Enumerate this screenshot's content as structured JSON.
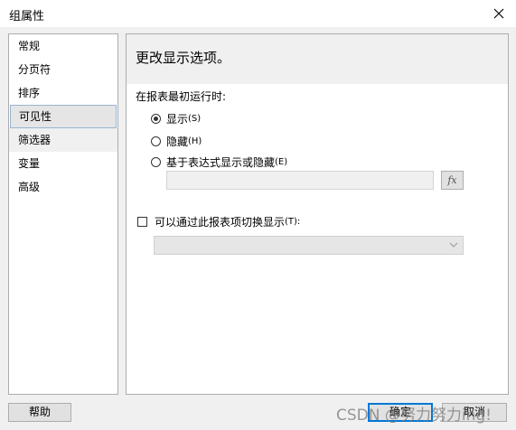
{
  "window": {
    "title": "组属性"
  },
  "sidebar": {
    "items": [
      {
        "label": "常规"
      },
      {
        "label": "分页符"
      },
      {
        "label": "排序"
      },
      {
        "label": "可见性"
      },
      {
        "label": "筛选器"
      },
      {
        "label": "变量"
      },
      {
        "label": "高级"
      }
    ],
    "selected": "可见性"
  },
  "content": {
    "header": "更改显示选项。",
    "initial_label": "在报表最初运行时:",
    "options": [
      {
        "label": "显示",
        "shortcut": "(S)",
        "checked": true
      },
      {
        "label": "隐藏",
        "shortcut": "(H)",
        "checked": false
      },
      {
        "label": "基于表达式显示或隐藏",
        "shortcut": "(E)",
        "checked": false
      }
    ],
    "expression_value": "",
    "fx_label": "fx",
    "toggle": {
      "label": "可以通过此报表项切换显示",
      "shortcut": "(T):",
      "checked": false
    },
    "toggle_select_value": ""
  },
  "footer": {
    "help": "帮助",
    "ok": "确定",
    "cancel": "取消"
  },
  "watermark": "CSDN @努力努力ing!",
  "colors": {
    "focus_border": "#0078d7",
    "panel_bg": "#f0f0f0"
  }
}
